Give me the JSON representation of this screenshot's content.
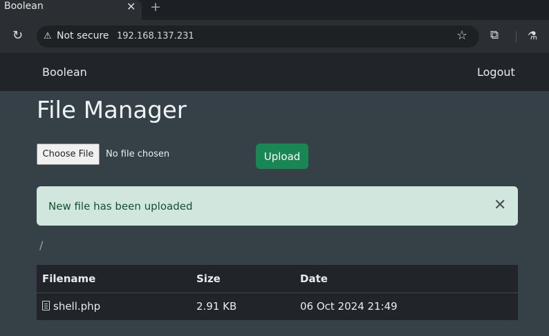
{
  "browser": {
    "tab_title": "Boolean",
    "tab_close": "✕",
    "new_tab": "+",
    "security_label": "Not secure",
    "url": "192.168.137.231",
    "icons": [
      "reload-icon",
      "warning-icon",
      "star-icon",
      "extensions-icon",
      "labs-icon"
    ]
  },
  "navbar": {
    "brand": "Boolean",
    "logout": "Logout"
  },
  "page": {
    "title": "File Manager"
  },
  "upload_form": {
    "choose_label": "Choose File",
    "file_status": "No file chosen",
    "upload_label": "Upload",
    "upload_color": "#198754"
  },
  "alert": {
    "message": "New file has been uploaded",
    "close": "✕",
    "bg_color": "#d1e7dd"
  },
  "breadcrumb": {
    "path": "/"
  },
  "files_table": {
    "headers": [
      "Filename",
      "Size",
      "Date"
    ],
    "rows": [
      {
        "name": "shell.php",
        "size": "2.91 KB",
        "date": "06 Oct 2024 21:49"
      }
    ]
  }
}
